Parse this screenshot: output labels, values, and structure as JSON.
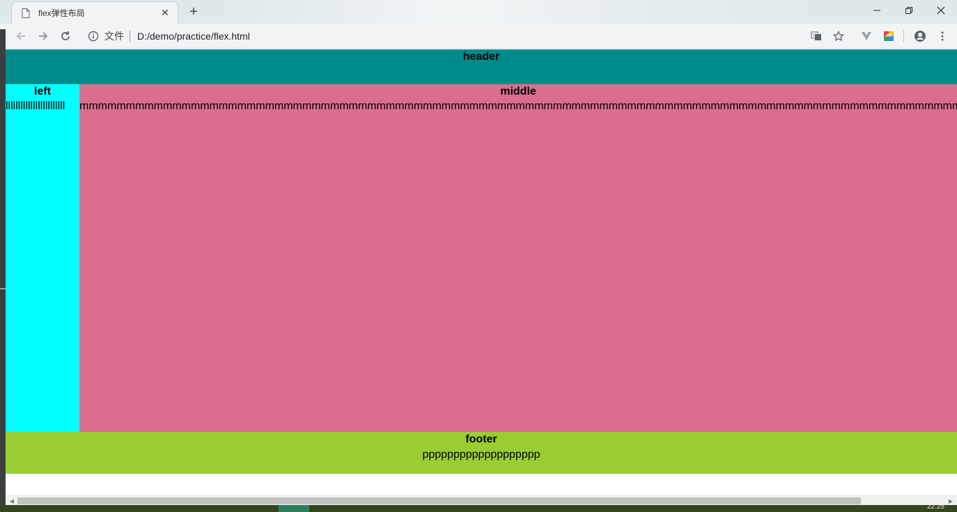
{
  "browser": {
    "tab": {
      "title": "flex弹性布局",
      "close_glyph": "✕"
    },
    "new_tab_glyph": "+",
    "window_controls": {
      "minimize": "—",
      "restore": "❐",
      "close": "✕"
    },
    "address": {
      "scheme_label": "文件",
      "url": "D:/demo/practice/flex.html"
    }
  },
  "page": {
    "header": {
      "title": "header"
    },
    "left": {
      "title": "left",
      "filler": "llllllllllllllllllllllll"
    },
    "middle": {
      "title": "middle",
      "filler": "mmmmmmmmmmmmmmmmmmmmmmmmmmmmmmmmmmmmmmmmmmmmmmmmmmmmmmmmmmmmmmmmmmmmmmmmmmmmmmmmmmmmmmmmmmmmmmmmmmmmm"
    },
    "footer": {
      "title": "footer",
      "filler": "ppppppppppppppppppp"
    },
    "colors": {
      "header": "#008b8b",
      "left": "#00ffff",
      "middle": "#db6e8f",
      "footer": "#9acd32"
    }
  },
  "taskbar": {
    "clock": "22:25"
  }
}
